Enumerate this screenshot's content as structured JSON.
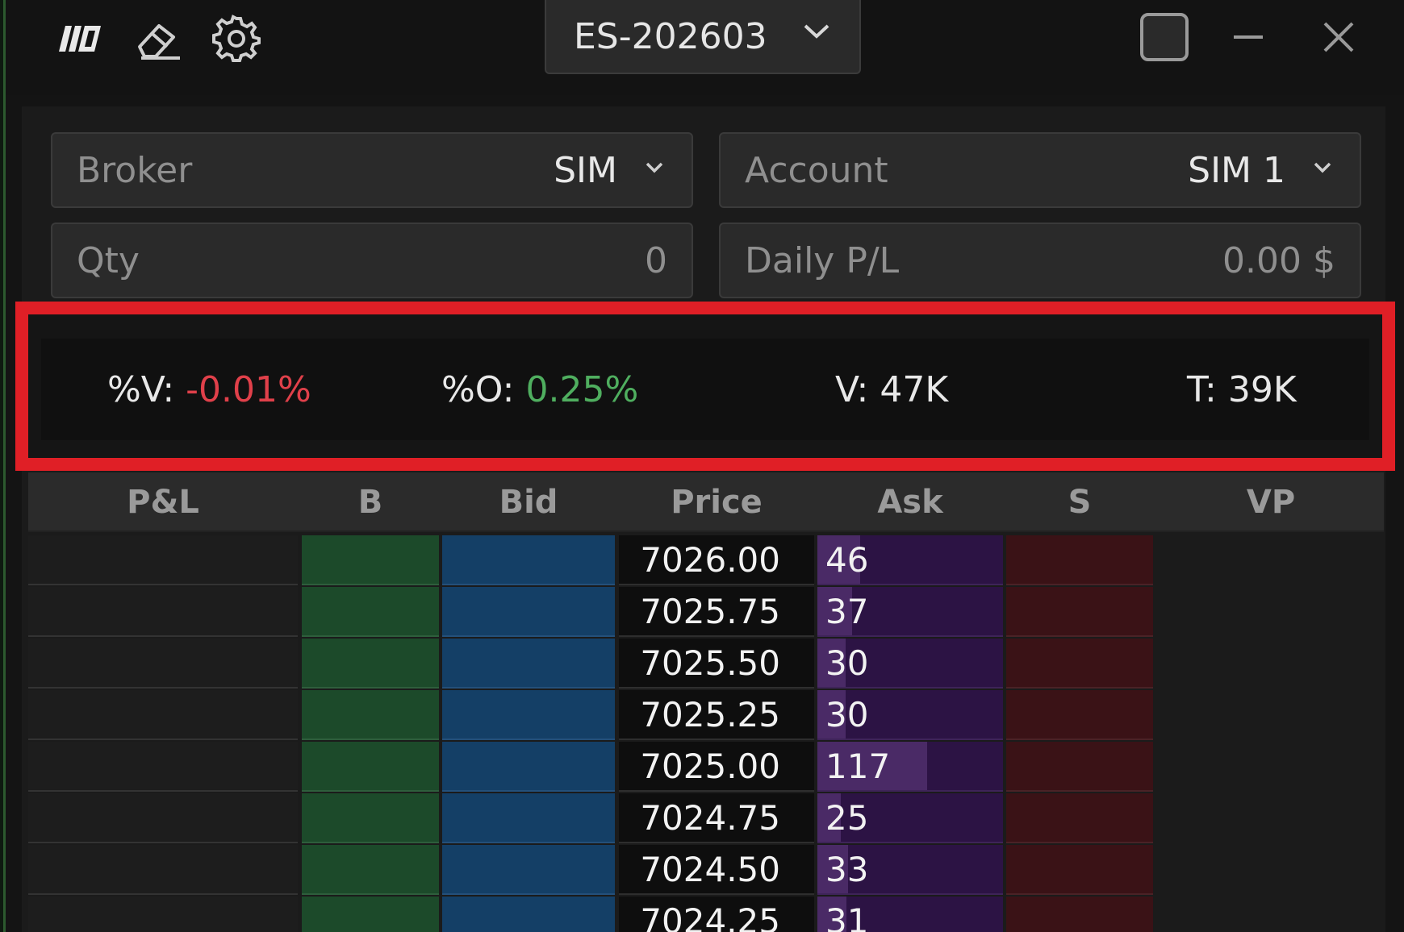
{
  "titlebar": {
    "symbol": "ES-202603",
    "icons": {
      "logo": "logo-icon",
      "clear": "eraser-icon",
      "settings": "gear-icon",
      "dropdown": "chevron-down-icon",
      "maximize": "square-icon",
      "minimize": "minus-icon",
      "close": "close-icon"
    }
  },
  "form": {
    "broker": {
      "label": "Broker",
      "value": "SIM"
    },
    "account": {
      "label": "Account",
      "value": "SIM 1"
    },
    "qty": {
      "label": "Qty",
      "value": "0"
    },
    "daily_pl": {
      "label": "Daily P/L",
      "value": "0.00 $"
    }
  },
  "stats": {
    "pct_vwap": {
      "label": "%V:",
      "value": "-0.01%",
      "color": "#e0404a"
    },
    "pct_open": {
      "label": "%O:",
      "value": "0.25%",
      "color": "#4fae5f"
    },
    "volume": {
      "label": "V:",
      "value": "47K"
    },
    "trades": {
      "label": "T:",
      "value": "39K"
    },
    "highlight_color": "#e01f26"
  },
  "ladder": {
    "columns": [
      "P&L",
      "B",
      "Bid",
      "Price",
      "Ask",
      "S",
      "VP"
    ],
    "rows": [
      {
        "price": "7026.00",
        "ask": "46"
      },
      {
        "price": "7025.75",
        "ask": "37"
      },
      {
        "price": "7025.50",
        "ask": "30"
      },
      {
        "price": "7025.25",
        "ask": "30"
      },
      {
        "price": "7025.00",
        "ask": "117"
      },
      {
        "price": "7024.75",
        "ask": "25"
      },
      {
        "price": "7024.50",
        "ask": "33"
      },
      {
        "price": "7024.25",
        "ask": "31"
      }
    ],
    "colors": {
      "buy": "#1c4a2a",
      "bid": "#143f66",
      "ask": "#2c1344",
      "sell": "#3a1216"
    }
  }
}
